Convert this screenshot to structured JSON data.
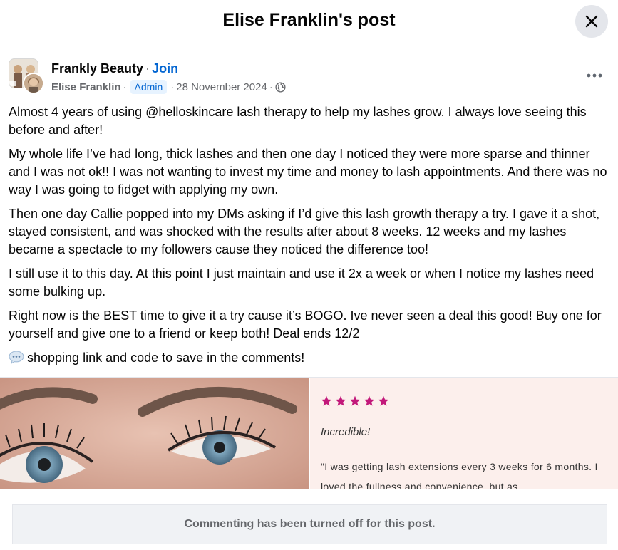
{
  "header": {
    "title": "Elise Franklin's post",
    "close_icon": "close-icon"
  },
  "post": {
    "group_name": "Frankly Beauty",
    "separator": "·",
    "join_label": "Join",
    "author": "Elise Franklin",
    "role_badge": "Admin",
    "date": "28 November 2024",
    "audience_icon": "globe-icon",
    "more_icon": "more-horizontal-icon",
    "paragraphs": [
      "Almost 4 years of using @helloskincare lash therapy to help my lashes grow. I always love seeing this before and after!",
      "My whole life I’ve had long, thick lashes and then one day I noticed they were more sparse and thinner and I was not ok!! I was not wanting to invest my time and money to lash appointments. And there was no way I was going to fidget with applying my own.",
      "Then one day Callie popped into my DMs asking if I’d give this lash growth therapy a try. I gave it a shot, stayed consistent, and was shocked with the results after about 8 weeks. 12 weeks and my lashes became a spectacle to my followers cause they noticed the difference too!",
      "I still use it to this day. At this point I just maintain and use it 2x a week or when I notice my lashes need some bulking up.",
      "Right now is the BEST time to give it a try cause it’s BOGO. Ive never seen a deal this good! Buy one for yourself and give one to a friend or keep both! Deal ends 12/2"
    ],
    "last_line": "shopping link and code to save in the comments!",
    "last_line_icon": "speech-bubble-icon"
  },
  "media": {
    "review": {
      "rating": 5,
      "title": "Incredible!",
      "text": "\"I was getting lash extensions every 3 weeks for 6 months. I loved the fullness and convenience, but as"
    },
    "colors": {
      "stars": "#c2187a",
      "review_bg": "#fcefec"
    }
  },
  "footer": {
    "comment_notice": "Commenting has been turned off for this post."
  }
}
